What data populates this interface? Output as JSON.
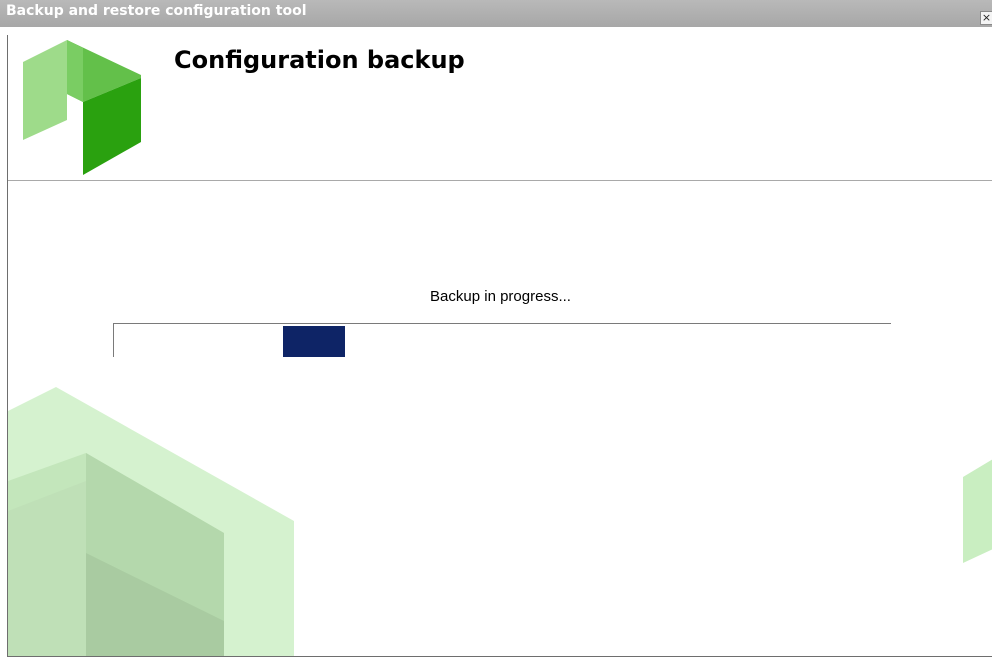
{
  "window": {
    "title": "Backup and restore configuration tool",
    "close_label": "×"
  },
  "header": {
    "title": "Configuration backup",
    "logo_icon": "green-hexagon-logo-icon"
  },
  "main": {
    "status_text": "Backup in progress...",
    "progress": {
      "mode": "indeterminate",
      "chunk_color": "#0e2466"
    }
  },
  "colors": {
    "brand_green_dark": "#2aa10f",
    "brand_green_mid": "#63c04a",
    "brand_green_light": "#9edb8a",
    "deco_green": "#c9eec1",
    "titlebar_gray": "#acacac"
  }
}
